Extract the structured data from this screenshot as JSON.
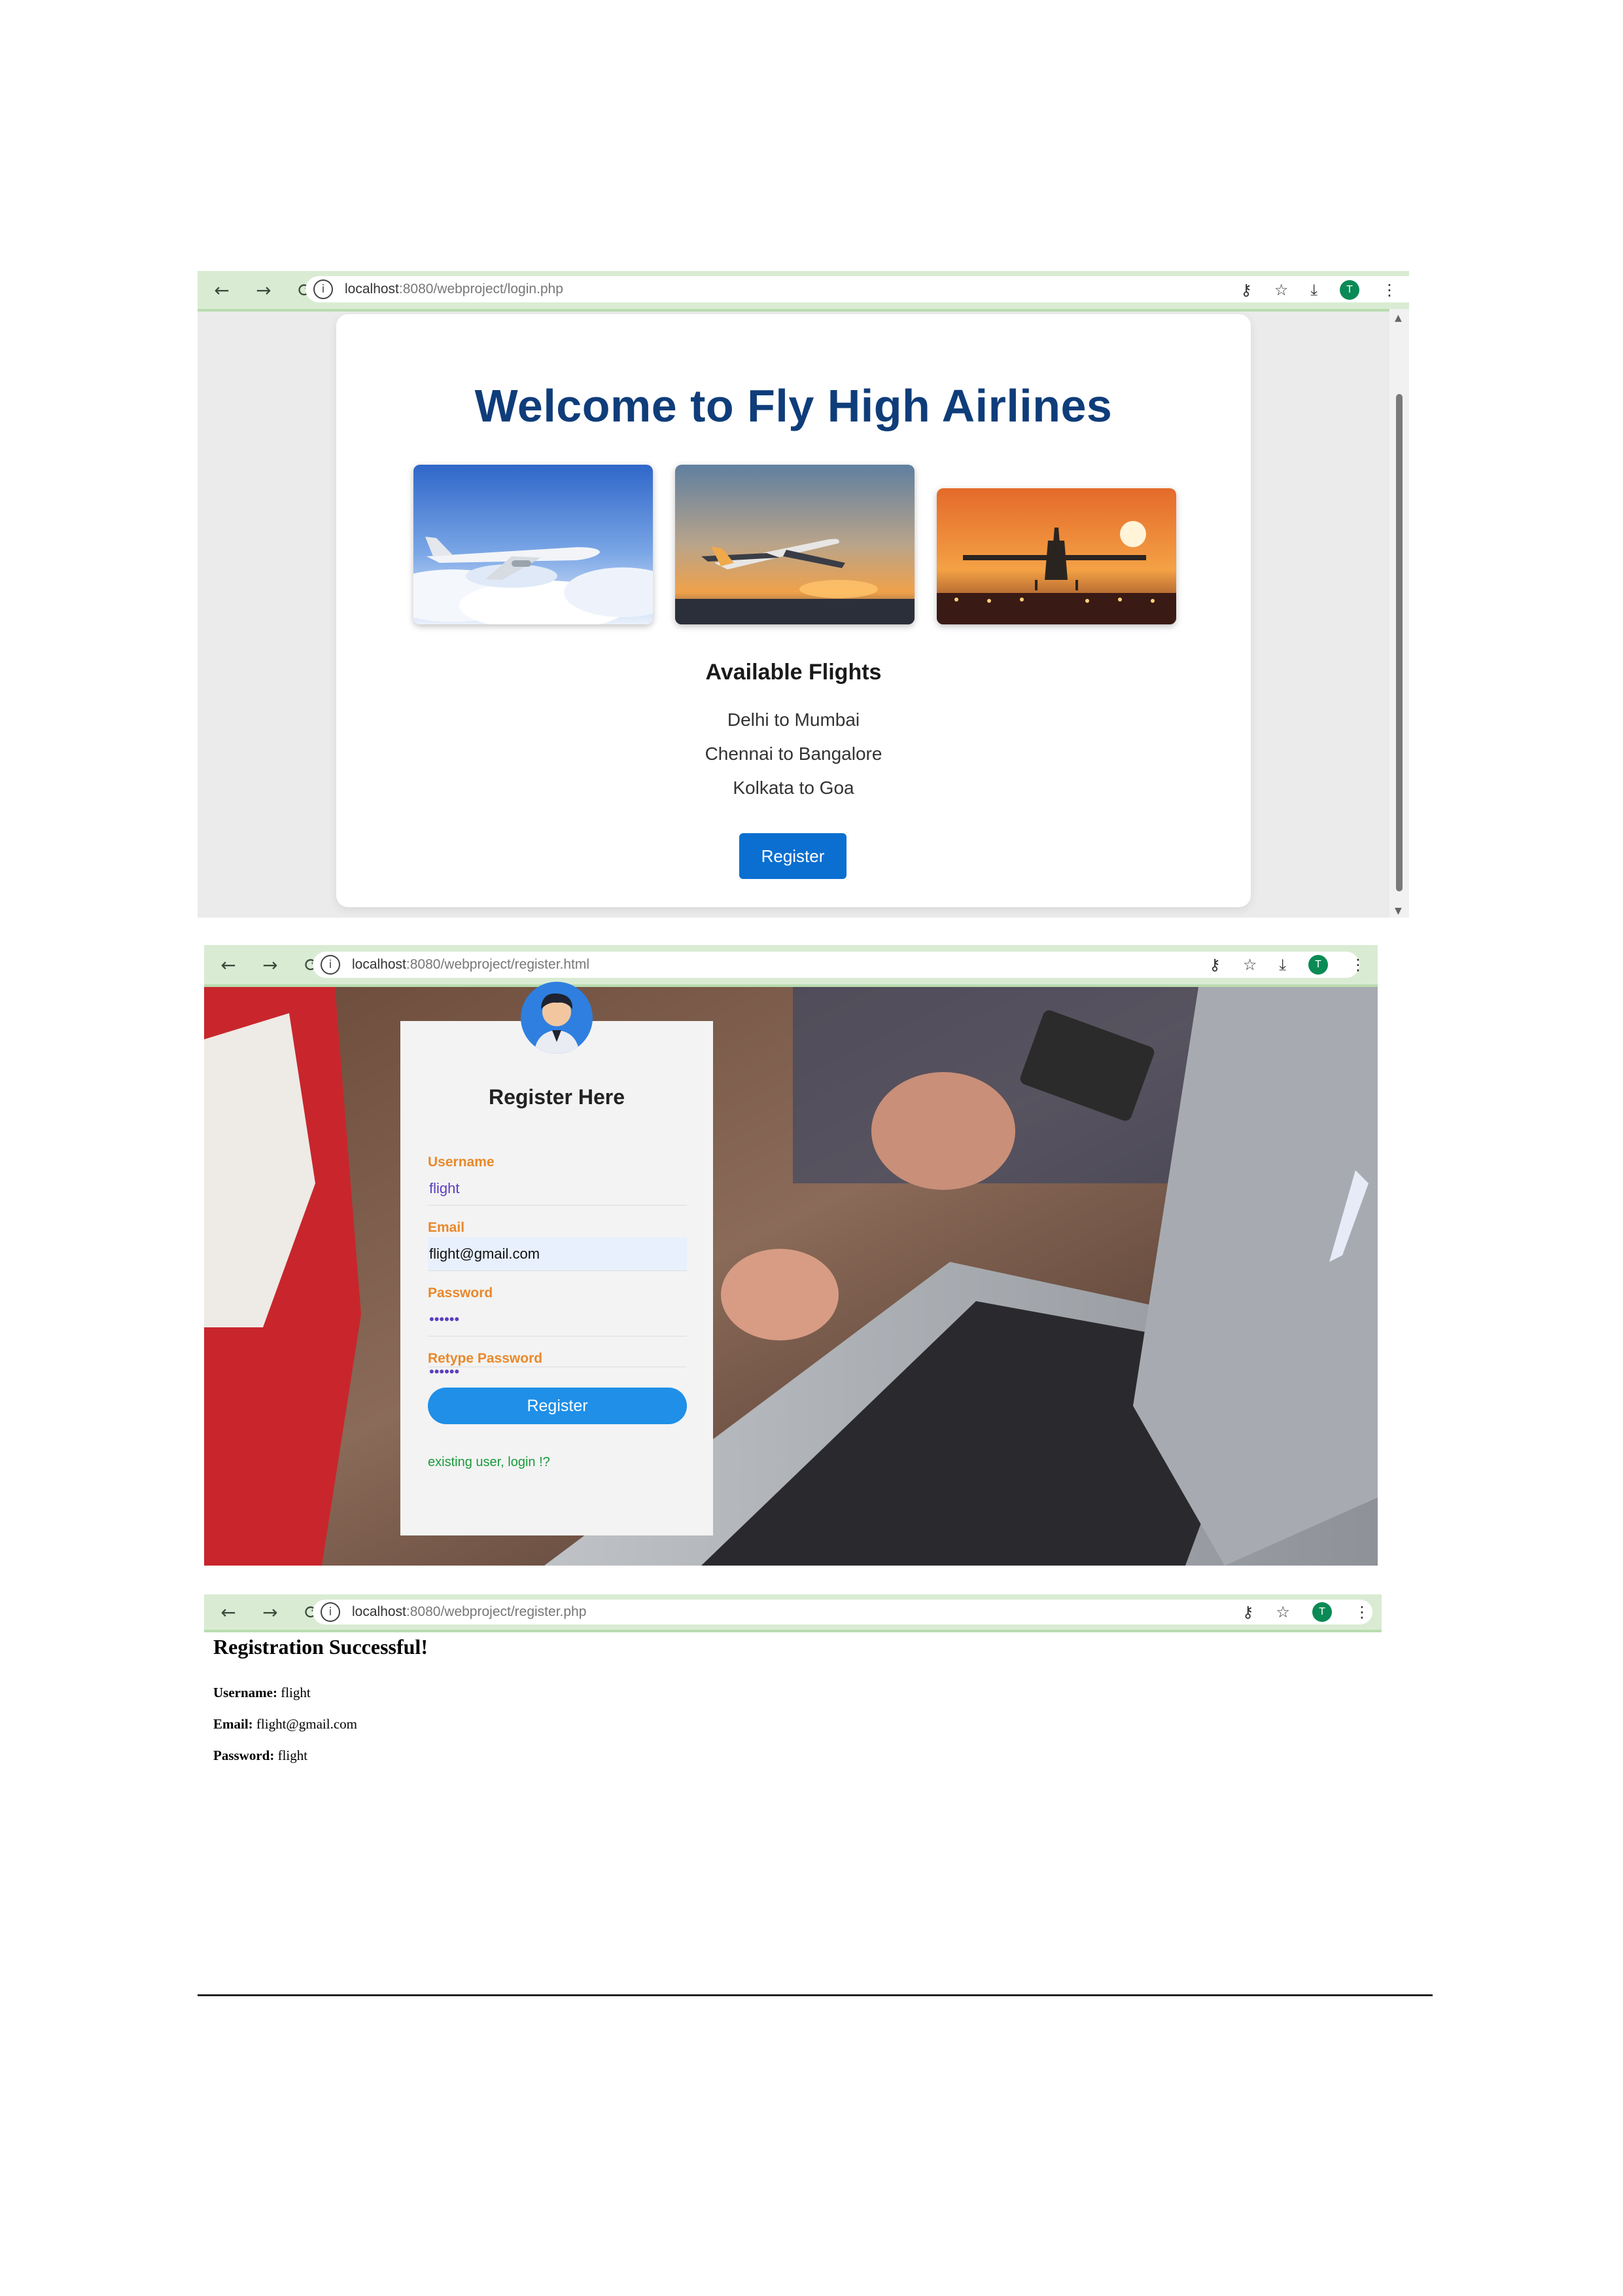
{
  "shot1": {
    "url_host": "localhost",
    "url_rest": ":8080/webproject/login.php",
    "title": "Welcome to Fly High Airlines",
    "flights_heading": "Available Flights",
    "flights": [
      "Delhi to Mumbai",
      "Chennai to Bangalore",
      "Kolkata to Goa"
    ],
    "register_button": "Register",
    "profile_initial": "T"
  },
  "shot2": {
    "url_host": "localhost",
    "url_rest": ":8080/webproject/register.html",
    "heading": "Register Here",
    "username_label": "Username",
    "username_value": "flight",
    "email_label": "Email",
    "email_value": "flight@gmail.com",
    "password_label": "Password",
    "password_value": "••••••",
    "retype_label": "Retype Password",
    "retype_value": "••••••",
    "register_button": "Register",
    "existing_link": "existing user, login !?",
    "profile_initial": "T"
  },
  "shot3": {
    "url_host": "localhost",
    "url_rest": ":8080/webproject/register.php",
    "heading": "Registration Successful!",
    "username_label": "Username:",
    "username_value": "flight",
    "email_label": "Email:",
    "email_value": "flight@gmail.com",
    "password_label": "Password:",
    "password_value": "flight",
    "profile_initial": "T"
  },
  "icons": [
    "back-icon",
    "forward-icon",
    "reload-icon",
    "site-info-icon",
    "password-key-icon",
    "star-icon",
    "download-icon",
    "profile-icon",
    "menu-icon"
  ],
  "colors": {
    "title_blue": "#0f3d7a",
    "button_blue": "#0a6fd0",
    "label_orange": "#e8892b",
    "link_green": "#1a9a3c",
    "chrome_green": "#d9ecd3"
  }
}
